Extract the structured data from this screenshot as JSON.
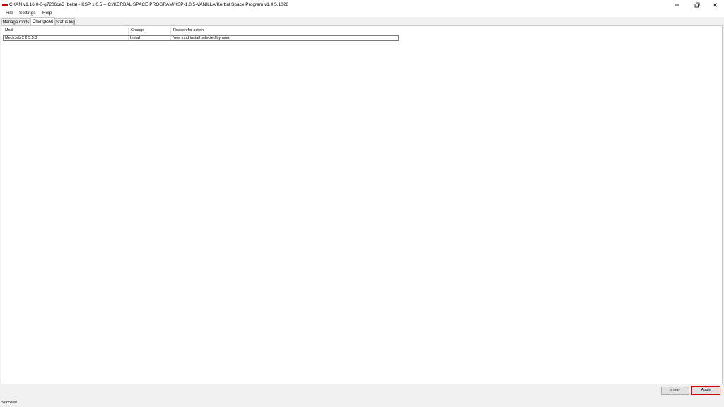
{
  "window": {
    "title": "CKAN v1.16.0-0-g7206ce5 (beta) - KSP 1.0.5  --  C:/KERBAL SPACE PROGRAM/KSP-1.0.5-VANILLA/Kerbal Space Program v1.0.5.1028",
    "icon": "ckan-app-icon",
    "accent_color": "#d40000"
  },
  "menu": {
    "file": "File",
    "settings": "Settings",
    "help": "Help"
  },
  "tabs": [
    {
      "label": "Manage mods",
      "selected": false
    },
    {
      "label": "Changeset",
      "selected": true
    },
    {
      "label": "Status log",
      "selected": false
    }
  ],
  "changeset": {
    "columns": [
      "Mod",
      "Change",
      "Reason for action"
    ],
    "rows": [
      {
        "mod": "MechJeb 2 2.5.5.0",
        "change": "Install",
        "reason": "New mod install selected by user."
      }
    ]
  },
  "buttons": {
    "clear": "Clear",
    "apply": "Apply"
  },
  "status": {
    "text": "Success!"
  }
}
